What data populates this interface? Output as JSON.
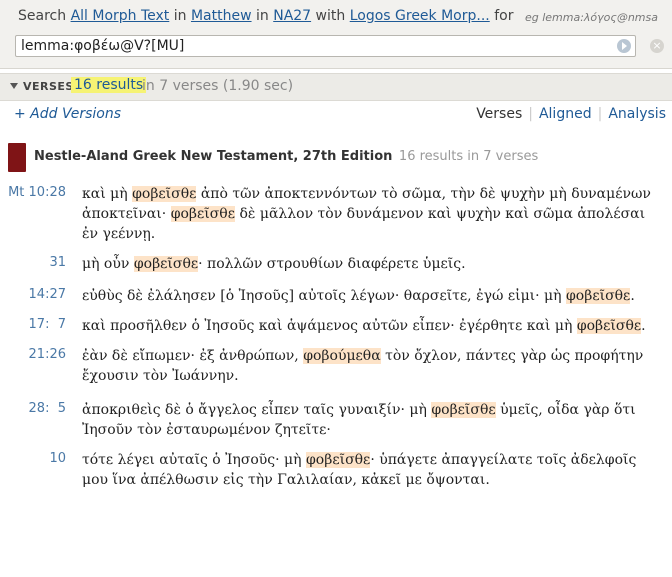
{
  "search": {
    "prefix": "Search",
    "scope": "All Morph Text",
    "in1": "in",
    "book": "Matthew",
    "in2": "in",
    "version": "NA27",
    "with": "with",
    "morph": "Logos Greek Morp...",
    "for": "for",
    "example": "eg lemma:λόγος@nmsa",
    "query": "lemma:φοβέω@V?[MU]"
  },
  "results": {
    "label": "VERSES",
    "count": "16 results",
    "meta": "in 7 verses (1.90 sec)"
  },
  "versions": {
    "add": "+ Add Versions",
    "tabs": [
      "Verses",
      "Aligned",
      "Analysis"
    ]
  },
  "book": {
    "title": "Nestle-Aland Greek New Testament, 27th Edition",
    "subtitle": "16 results in 7 verses"
  },
  "verses": [
    {
      "ref": "Mt 10:28",
      "parts": [
        {
          "t": "καὶ μὴ "
        },
        {
          "t": "φοβεῖσθε",
          "h": true
        },
        {
          "t": " ἀπὸ τῶν ἀποκτεννόντων τὸ σῶμα, τὴν δὲ ψυχὴν μὴ δυναμένων ἀποκτεῖναι· "
        },
        {
          "t": "φοβεῖσθε",
          "h": true
        },
        {
          "t": " δὲ μᾶλλον τὸν δυνάμενον καὶ ψυχὴν καὶ σῶμα ἀπολέσαι ἐν γεέννῃ."
        }
      ]
    },
    {
      "ref": "31",
      "parts": [
        {
          "t": "μὴ οὖν "
        },
        {
          "t": "φοβεῖσθε",
          "h": true
        },
        {
          "t": "· πολλῶν στρουθίων διαφέρετε ὑμεῖς."
        }
      ]
    },
    {
      "ref": "14:27",
      "parts": [
        {
          "t": "εὐθὺς δὲ ἐλάλησεν [ὁ Ἰησοῦς] αὐτοῖς λέγων· θαρσεῖτε, ἐγώ εἰμι· μὴ "
        },
        {
          "t": "φοβεῖσθε",
          "h": true
        },
        {
          "t": "."
        }
      ]
    },
    {
      "ref": "17:  7",
      "parts": [
        {
          "t": "καὶ προσῆλθεν ὁ Ἰησοῦς καὶ ἁψάμενος αὐτῶν εἶπεν· ἐγέρθητε καὶ μὴ "
        },
        {
          "t": "φοβεῖσθε",
          "h": true
        },
        {
          "t": "."
        }
      ]
    },
    {
      "ref": "21:26",
      "parts": [
        {
          "t": "ἐὰν δὲ εἴπωμεν· ἐξ ἀνθρώπων, "
        },
        {
          "t": "φοβούμεθα",
          "h": true
        },
        {
          "t": " τὸν ὄχλον, πάντες γὰρ ὡς προφήτην ἔχουσιν τὸν Ἰωάννην."
        }
      ]
    },
    {
      "ref": "28:  5",
      "parts": [
        {
          "t": "ἀποκριθεὶς δὲ ὁ ἄγγελος εἶπεν ταῖς γυναιξίν· μὴ "
        },
        {
          "t": "φοβεῖσθε",
          "h": true
        },
        {
          "t": " ὑμεῖς, οἶδα γὰρ ὅτι Ἰησοῦν τὸν ἐσταυρωμένον ζητεῖτε·"
        }
      ]
    },
    {
      "ref": "10",
      "parts": [
        {
          "t": "τότε λέγει αὐταῖς ὁ Ἰησοῦς· μὴ "
        },
        {
          "t": "φοβεῖσθε",
          "h": true
        },
        {
          "t": "· ὑπάγετε ἀπαγγείλατε τοῖς ἀδελφοῖς μου ἵνα ἀπέλθωσιν εἰς τὴν Γαλιλαίαν, κἀκεῖ με ὄψονται."
        }
      ]
    }
  ]
}
